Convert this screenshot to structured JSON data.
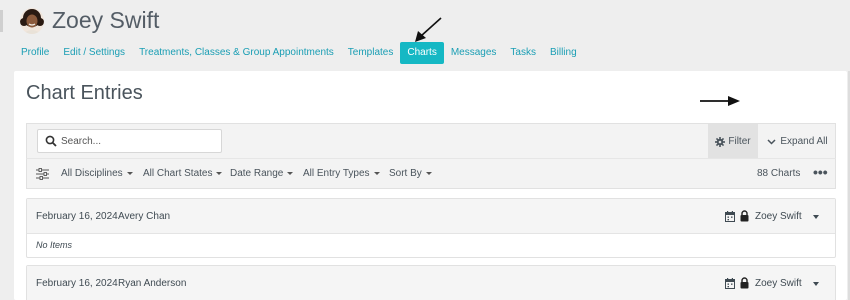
{
  "client": {
    "name": "Zoey Swift"
  },
  "tabs": [
    {
      "label": "Profile"
    },
    {
      "label": "Edit / Settings"
    },
    {
      "label": "Treatments, Classes & Group Appointments"
    },
    {
      "label": "Templates"
    },
    {
      "label": "Charts",
      "active": true
    },
    {
      "label": "Messages"
    },
    {
      "label": "Tasks"
    },
    {
      "label": "Billing"
    }
  ],
  "page": {
    "title": "Chart Entries"
  },
  "toolbar": {
    "search_placeholder": "Search...",
    "filter_label": "Filter",
    "expand_label": "Expand All"
  },
  "filters": {
    "disciplines": "All Disciplines",
    "chart_states": "All Chart States",
    "date_range": "Date Range",
    "entry_types": "All Entry Types",
    "sort_by": "Sort By",
    "count_label": "88 Charts",
    "more_label": "•••"
  },
  "entries": [
    {
      "date": "February 16, 2024",
      "patient": "Avery Chan",
      "user": "Zoey Swift",
      "body": "No Items"
    },
    {
      "date": "February 16, 2024",
      "patient": "Ryan Anderson",
      "user": "Zoey Swift",
      "body": ""
    }
  ],
  "colors": {
    "accent": "#15b8c4",
    "link": "#1a9eb4",
    "text": "#3f4a52",
    "background": "#eeeeee"
  }
}
